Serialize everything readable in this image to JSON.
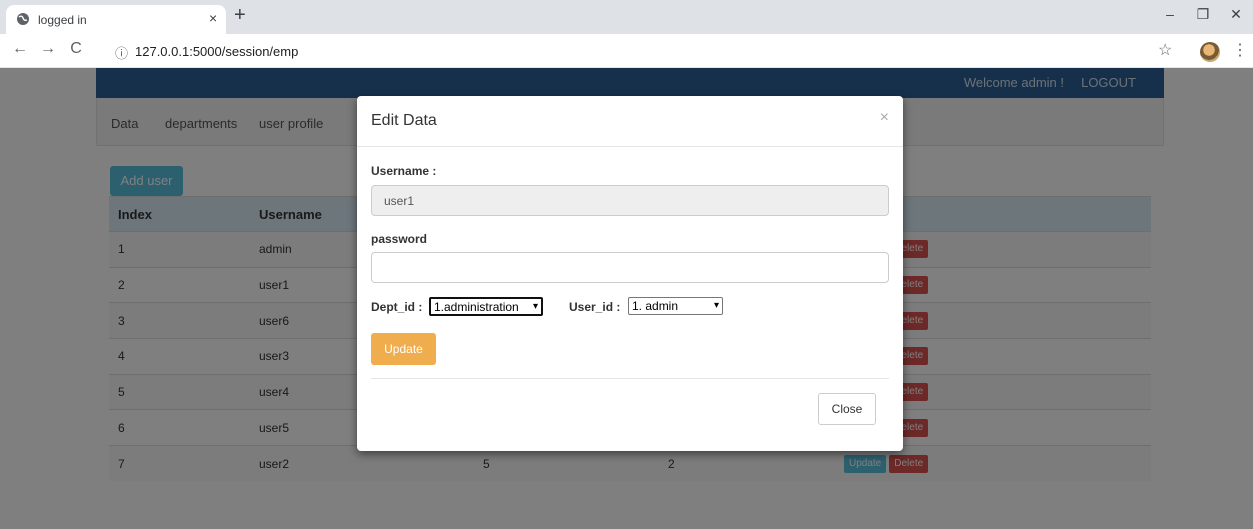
{
  "browser": {
    "tab_title": "logged in",
    "tab_close": "×",
    "new_tab": "+",
    "url": "127.0.0.1:5000/session/emp",
    "back": "←",
    "forward": "→",
    "reload": "C",
    "info": "ⓘ",
    "bookmark": "☆",
    "menu": "⋮",
    "minimize": "–",
    "restore": "❐",
    "close": "✕"
  },
  "header": {
    "welcome": "Welcome admin !",
    "logout": "LOGOUT"
  },
  "subnav": [
    "Data",
    "departments",
    "user profile"
  ],
  "add_user_label": "Add user",
  "table": {
    "columns": [
      "Index",
      "Username",
      "",
      "",
      ""
    ],
    "rows": [
      {
        "index": "1",
        "username": "admin",
        "c3": "",
        "c4": ""
      },
      {
        "index": "2",
        "username": "user1",
        "c3": "",
        "c4": ""
      },
      {
        "index": "3",
        "username": "user6",
        "c3": "",
        "c4": ""
      },
      {
        "index": "4",
        "username": "user3",
        "c3": "",
        "c4": ""
      },
      {
        "index": "5",
        "username": "user4",
        "c3": "",
        "c4": ""
      },
      {
        "index": "6",
        "username": "user5",
        "c3": "",
        "c4": ""
      },
      {
        "index": "7",
        "username": "user2",
        "c3": "5",
        "c4": "2"
      }
    ],
    "update_label": "Update",
    "delete_label": "Delete"
  },
  "modal": {
    "title": "Edit Data",
    "close_x": "×",
    "username_label": "Username :",
    "username_value": "user1",
    "password_label": "password",
    "password_value": "",
    "dept_label": "Dept_id :",
    "dept_selected": "1.administration",
    "user_label": "User_id :",
    "user_selected": "1. admin",
    "update_label": "Update",
    "close_label": "Close"
  },
  "colors": {
    "nav": "#2c6199",
    "info": "#5bc0de",
    "danger": "#d9534f",
    "warning": "#f0ad4e"
  }
}
